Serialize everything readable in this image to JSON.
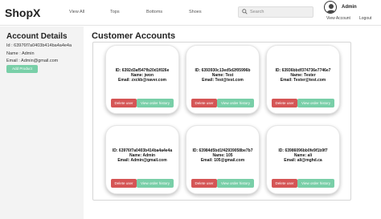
{
  "header": {
    "brand": "ShopX",
    "nav": [
      "View All",
      "Tops",
      "Bottoms",
      "Shoes"
    ],
    "search_placeholder": "Search",
    "user_name": "Admin",
    "view_account": "View Account",
    "logout": "Logout"
  },
  "sidebar": {
    "title": "Account Details",
    "id_line": "Id : 63976f7a0403b414ba4a4e4a",
    "name_line": "Name : Admin",
    "email_line": "Email : Admin@gmail.com",
    "add_product": "Add Product"
  },
  "main": {
    "title": "Customer Accounts",
    "delete_label": "Delete user",
    "history_label": "View order history",
    "cards": [
      {
        "id": "ID: 6392d3af547fb20d1f026e",
        "name": "Name: jwon",
        "email": "Email: zxckb@naver.com"
      },
      {
        "id": "ID: 6393930c13ed5d2f05996b",
        "name": "Name: Test",
        "email": "Email: Test@test.com"
      },
      {
        "id": "ID: 63936bbdf374736e7746e7",
        "name": "Name: Tester",
        "email": "Email: Tester@test.com"
      },
      {
        "id": "ID: 63976f7a0403b414ba4a4e4a",
        "name": "Name: Admin",
        "email": "Email: Admin@gmail.com"
      },
      {
        "id": "ID: 63984d5bd1f42939058be7b7",
        "name": "Name: 105",
        "email": "Email: 105@gmail.com"
      },
      {
        "id": "ID: 63986096bb0fe9f1b9f7",
        "name": "Name: ali",
        "email": "Email: ali@mghd.ca"
      }
    ]
  }
}
